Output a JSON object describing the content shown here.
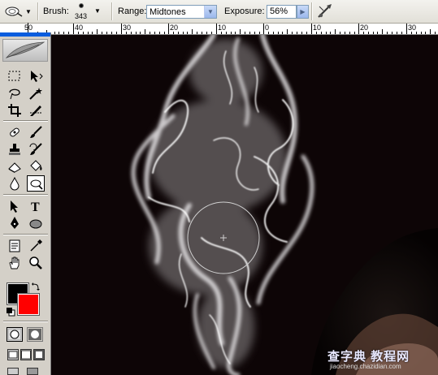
{
  "options_bar": {
    "brush_label": "Brush:",
    "brush_size": "343",
    "range_label": "Range:",
    "range_value": "Midtones",
    "exposure_label": "Exposure:",
    "exposure_value": "56%"
  },
  "ruler": {
    "left_label": "50",
    "labels": [
      "40",
      "30",
      "20",
      "10",
      "0",
      "10",
      "20",
      "30"
    ]
  },
  "toolbox": {
    "active_tool": "dodge-tool",
    "foreground_color": "#000000",
    "background_color": "#ff0000"
  },
  "watermark": {
    "logo_text": "查字典 教程网",
    "url": "jiaocheng.chazidian.com"
  }
}
